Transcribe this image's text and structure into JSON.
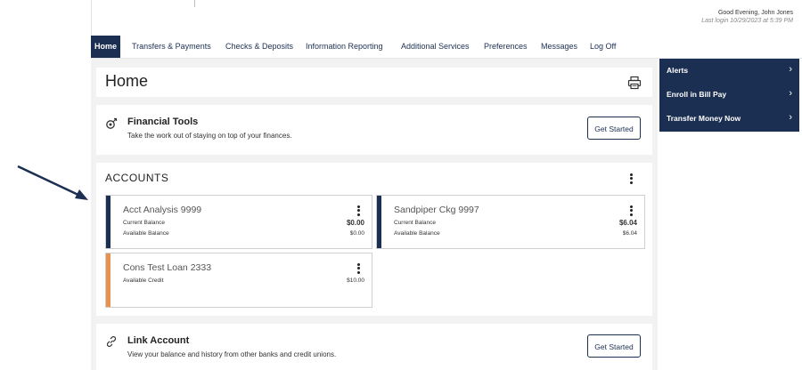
{
  "header": {
    "greeting": "Good Evening, John Jones",
    "last_login": "Last login 10/29/2023 at 5:39 PM"
  },
  "nav": {
    "items": [
      {
        "label": "Home"
      },
      {
        "label": "Transfers & Payments"
      },
      {
        "label": "Checks & Deposits"
      },
      {
        "label": "Information Reporting"
      },
      {
        "label": "Additional Services"
      },
      {
        "label": "Preferences"
      },
      {
        "label": "Messages"
      },
      {
        "label": "Log Off"
      }
    ]
  },
  "home": {
    "title": "Home",
    "print_icon": "printer-icon"
  },
  "financial_tools": {
    "title": "Financial Tools",
    "description": "Take the work out of staying on top of your finances.",
    "button": "Get Started",
    "icon": "financial-tools-icon"
  },
  "accounts": {
    "title": "ACCOUNTS",
    "items": [
      {
        "name": "Acct Analysis 9999",
        "color": "#1b2f52",
        "rows": [
          {
            "label": "Current Balance",
            "value": "$0.00"
          },
          {
            "label": "Available Balance",
            "value": "$0.00"
          }
        ]
      },
      {
        "name": "Sandpiper Ckg 9997",
        "color": "#1b2f52",
        "rows": [
          {
            "label": "Current Balance",
            "value": "$6.04"
          },
          {
            "label": "Available Balance",
            "value": "$6.04"
          }
        ]
      },
      {
        "name": "Cons Test Loan 2333",
        "color": "#e8924f",
        "rows": [
          {
            "label": "Available Credit",
            "value": "$10.00"
          }
        ]
      }
    ]
  },
  "link_account": {
    "title": "Link Account",
    "description": "View your balance and history from other banks and credit unions.",
    "button": "Get Started",
    "icon": "link-icon"
  },
  "side_menu": {
    "items": [
      {
        "label": "Alerts"
      },
      {
        "label": "Enroll in Bill Pay"
      },
      {
        "label": "Transfer Money Now"
      }
    ]
  },
  "colors": {
    "brand_navy": "#1b2f52",
    "loan_accent": "#e8924f",
    "page_gray": "#f2f2f2"
  }
}
